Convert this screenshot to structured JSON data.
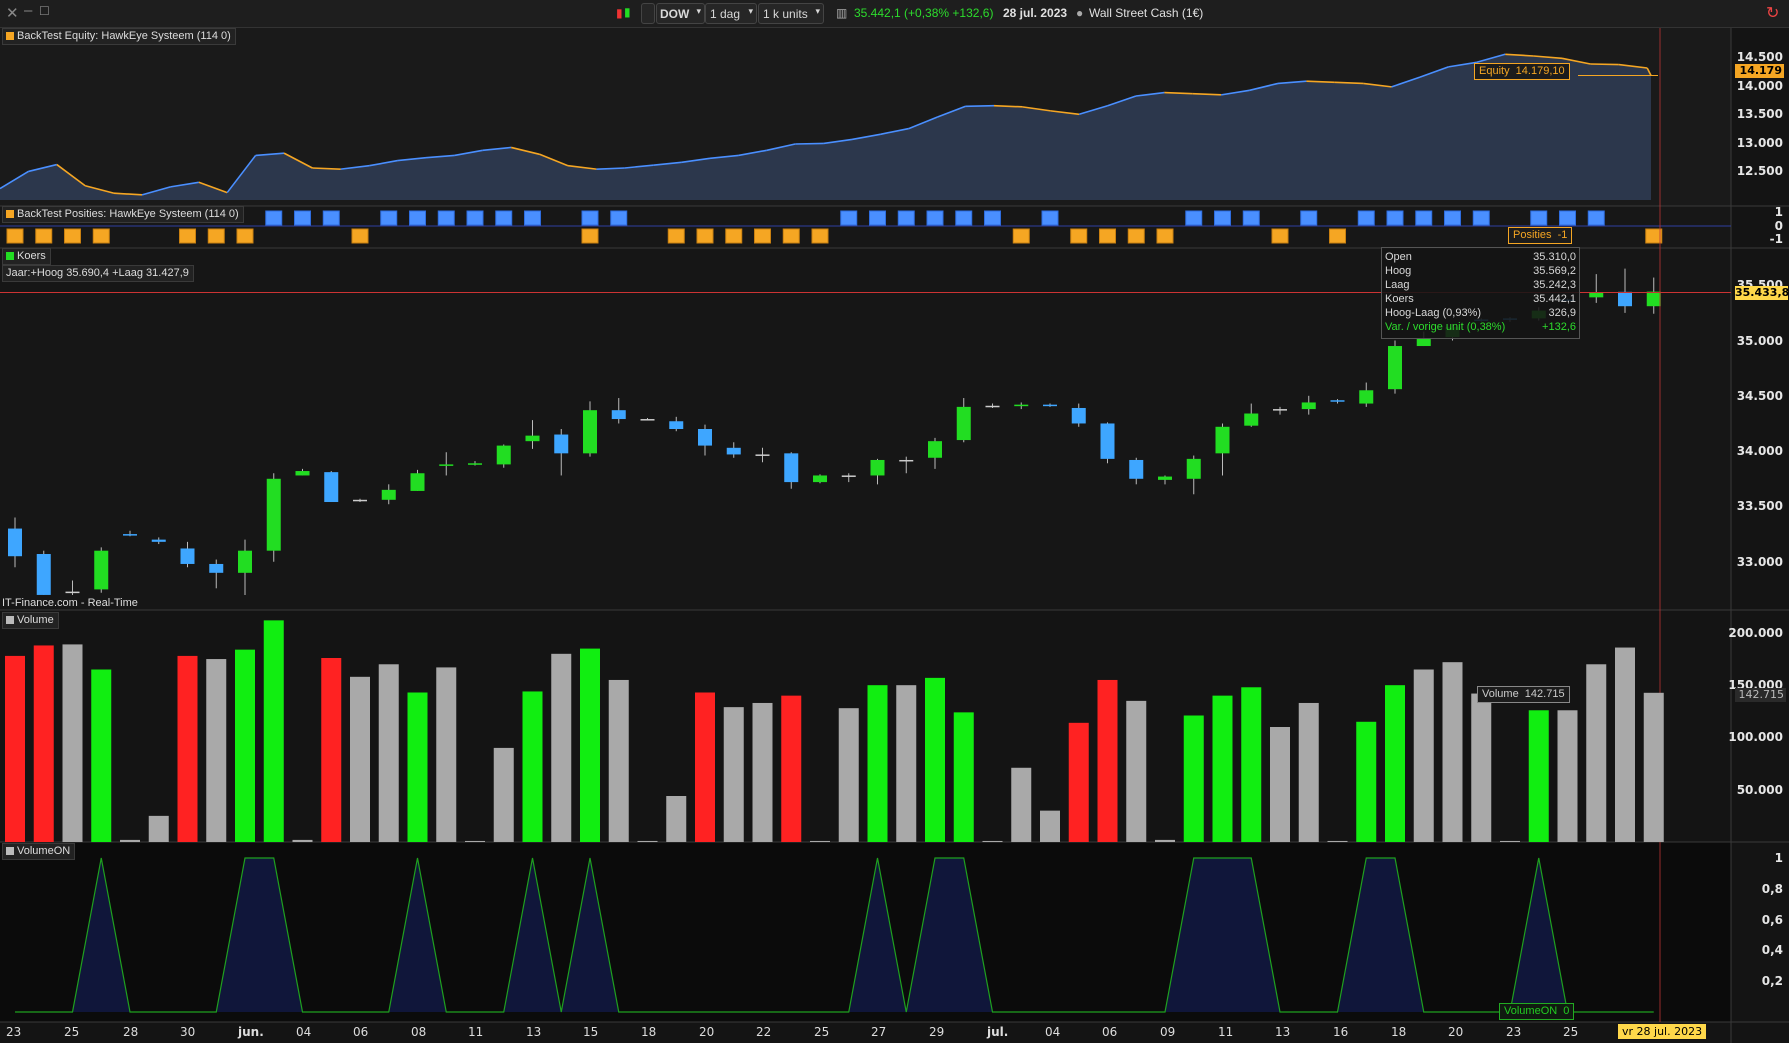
{
  "toolbar": {
    "symbol": "DOW",
    "period": "1 dag",
    "units": "1 k units",
    "quote": "35.442,1 (+0,38% +132,6)",
    "date": "28 jul. 2023",
    "instrument": "Wall Street Cash (1€)"
  },
  "panels": {
    "equity": {
      "label": "BackTest Equity: HawkEye Systeem (114 0)",
      "value_label": "Equity  14.179,10",
      "axis_value": "14.179",
      "ticks": [
        "14.500",
        "14.000",
        "13.500",
        "13.000",
        "12.500"
      ]
    },
    "positions": {
      "label": "BackTest Posities: HawkEye Systeem (114 0)",
      "value_label": "Posities  -1",
      "ticks": [
        "1",
        "0",
        "-1"
      ]
    },
    "price": {
      "label": "Koers",
      "subtitle": "Jaar:+Hoog 35.690,4 +Laag 31.427,9",
      "source": "IT-Finance.com - Real-Time",
      "current": "35.433,8",
      "ticks": [
        "35.500",
        "35.000",
        "34.500",
        "34.000",
        "33.500",
        "33.000"
      ]
    },
    "volume": {
      "label": "Volume",
      "value_label": "Volume  142.715",
      "current": "142.715",
      "ticks": [
        "200.000",
        "150.000",
        "100.000",
        "50.000"
      ]
    },
    "volumeon": {
      "label": "VolumeON",
      "value_label": "VolumeON  0",
      "ticks": [
        "1",
        "0,8",
        "0,6",
        "0,4",
        "0,2"
      ]
    }
  },
  "tooltip": [
    {
      "k": "Open",
      "v": "35.310,0"
    },
    {
      "k": "Hoog",
      "v": "35.569,2"
    },
    {
      "k": "Laag",
      "v": "35.242,3"
    },
    {
      "k": "Koers",
      "v": "35.442,1"
    },
    {
      "k": "Hoog-Laag (0,93%)",
      "v": "326,9"
    },
    {
      "k": "Var. / vorige unit (0,38%)",
      "v": "+132,6"
    }
  ],
  "xaxis": [
    "23",
    "25",
    "28",
    "30",
    "jun.",
    "04",
    "06",
    "08",
    "11",
    "13",
    "15",
    "18",
    "20",
    "22",
    "25",
    "27",
    "29",
    "jul.",
    "04",
    "06",
    "09",
    "11",
    "13",
    "16",
    "18",
    "20",
    "23",
    "25"
  ],
  "xaxis_current": "vr 28 jul. 2023",
  "colors": {
    "up": "#22dd22",
    "down": "#ff2222",
    "neutral": "#aaaaaa",
    "equity": "#f5a623",
    "equity_up": "#4a8fff",
    "blue_candle": "#3ea6ff"
  },
  "chart_data": [
    {
      "type": "line",
      "title": "BackTest Equity: HawkEye Systeem (114 0)",
      "ylim": [
        12000,
        14800
      ],
      "values": [
        12200,
        12500,
        12620,
        12250,
        12120,
        12090,
        12230,
        12310,
        12130,
        12780,
        12820,
        12560,
        12540,
        12600,
        12690,
        12740,
        12780,
        12870,
        12920,
        12800,
        12600,
        12540,
        12560,
        12610,
        12660,
        12730,
        12780,
        12870,
        12980,
        12990,
        13060,
        13150,
        13250,
        13450,
        13640,
        13650,
        13630,
        13560,
        13500,
        13650,
        13820,
        13880,
        13860,
        13840,
        13920,
        14040,
        14080,
        14060,
        14040,
        13980,
        14150,
        14330,
        14410,
        14550,
        14520,
        14480,
        14380,
        14370,
        14310,
        14179
      ]
    },
    {
      "type": "bar",
      "title": "Volume",
      "ylim": [
        0,
        220000
      ],
      "values": [
        178000,
        188000,
        189000,
        165000,
        2000,
        25000,
        178000,
        175000,
        184000,
        212000,
        2000,
        176000,
        158000,
        170000,
        143000,
        167000,
        1000,
        90000,
        144000,
        180000,
        185000,
        155000,
        1000,
        44000,
        143000,
        129000,
        133000,
        140000,
        1000,
        128000,
        150000,
        150000,
        157000,
        124000,
        1000,
        71000,
        30000,
        114000,
        155000,
        135000,
        2000,
        121000,
        140000,
        148000,
        110000,
        133000,
        1000,
        115000,
        150000,
        165000,
        172000,
        142000,
        1000,
        126000,
        126000,
        170000,
        186000,
        142715
      ],
      "colors": [
        "r",
        "r",
        "n",
        "g",
        "n",
        "n",
        "r",
        "n",
        "g",
        "g",
        "n",
        "r",
        "n",
        "n",
        "g",
        "n",
        "n",
        "n",
        "g",
        "n",
        "g",
        "n",
        "n",
        "n",
        "r",
        "n",
        "n",
        "r",
        "n",
        "n",
        "g",
        "n",
        "g",
        "g",
        "n",
        "n",
        "n",
        "r",
        "r",
        "n",
        "n",
        "g",
        "g",
        "g",
        "n",
        "n",
        "n",
        "g",
        "g",
        "n",
        "n",
        "n",
        "n",
        "g",
        "n",
        "n",
        "n",
        "n"
      ]
    },
    {
      "type": "line",
      "title": "VolumeON",
      "ylim": [
        0,
        1
      ],
      "values": [
        0,
        0,
        0,
        1,
        0,
        0,
        0,
        0,
        1,
        1,
        0,
        0,
        0,
        0,
        1,
        0,
        0,
        0,
        1,
        0,
        1,
        0,
        0,
        0,
        0,
        0,
        0,
        0,
        0,
        0,
        1,
        0,
        1,
        1,
        0,
        0,
        0,
        0,
        0,
        0,
        0,
        1,
        1,
        1,
        0,
        0,
        0,
        1,
        1,
        0,
        0,
        0,
        0,
        1,
        0,
        0,
        0,
        0
      ]
    },
    {
      "type": "candlestick",
      "title": "Koers",
      "ylim": [
        32600,
        35800
      ],
      "candles": [
        [
          33300,
          33050,
          33400,
          32950,
          "b"
        ],
        [
          33070,
          32700,
          33100,
          32700,
          "b"
        ],
        [
          32730,
          32720,
          32830,
          32700,
          "n"
        ],
        [
          32750,
          33100,
          33130,
          32720,
          "g"
        ],
        [
          33250,
          33240,
          33280,
          33230,
          "b"
        ],
        [
          33200,
          33180,
          33220,
          33160,
          "b"
        ],
        [
          33120,
          32980,
          33180,
          32950,
          "b"
        ],
        [
          32980,
          32900,
          33020,
          32760,
          "b"
        ],
        [
          32900,
          33100,
          33200,
          32700,
          "g"
        ],
        [
          33100,
          33750,
          33800,
          33000,
          "g"
        ],
        [
          33820,
          33780,
          33840,
          33780,
          "g"
        ],
        [
          33810,
          33540,
          33820,
          33540,
          "b"
        ],
        [
          33550,
          33560,
          33570,
          33540,
          "n"
        ],
        [
          33560,
          33650,
          33700,
          33520,
          "g"
        ],
        [
          33640,
          33800,
          33830,
          33640,
          "g"
        ],
        [
          33870,
          33880,
          33990,
          33780,
          "g"
        ],
        [
          33890,
          33880,
          33910,
          33870,
          "g"
        ],
        [
          33880,
          34050,
          34060,
          33850,
          "g"
        ],
        [
          34090,
          34140,
          34280,
          34020,
          "g"
        ],
        [
          34150,
          33980,
          34200,
          33780,
          "b"
        ],
        [
          33980,
          34370,
          34450,
          33950,
          "g"
        ],
        [
          34370,
          34290,
          34480,
          34250,
          "b"
        ],
        [
          34290,
          34290,
          34300,
          34280,
          "n"
        ],
        [
          34270,
          34200,
          34310,
          34180,
          "b"
        ],
        [
          34200,
          34050,
          34240,
          33960,
          "b"
        ],
        [
          34030,
          33970,
          34080,
          33940,
          "b"
        ],
        [
          33970,
          33960,
          34030,
          33900,
          "n"
        ],
        [
          33980,
          33720,
          33990,
          33660,
          "b"
        ],
        [
          33720,
          33780,
          33790,
          33710,
          "g"
        ],
        [
          33780,
          33780,
          33800,
          33720,
          "n"
        ],
        [
          33780,
          33920,
          33930,
          33700,
          "g"
        ],
        [
          33920,
          33920,
          33950,
          33800,
          "n"
        ],
        [
          33940,
          34090,
          34120,
          33840,
          "g"
        ],
        [
          34100,
          34400,
          34480,
          34080,
          "g"
        ],
        [
          34410,
          34410,
          34430,
          34390,
          "n"
        ],
        [
          34410,
          34420,
          34440,
          34380,
          "g"
        ],
        [
          34410,
          34420,
          34430,
          34400,
          "b"
        ],
        [
          34390,
          34250,
          34430,
          34220,
          "b"
        ],
        [
          34250,
          33930,
          34260,
          33890,
          "b"
        ],
        [
          33920,
          33750,
          33940,
          33700,
          "b"
        ],
        [
          33770,
          33740,
          33780,
          33700,
          "g"
        ],
        [
          33750,
          33930,
          33960,
          33610,
          "g"
        ],
        [
          33980,
          34220,
          34250,
          33780,
          "g"
        ],
        [
          34230,
          34340,
          34430,
          34220,
          "g"
        ],
        [
          34380,
          34380,
          34400,
          34330,
          "n"
        ],
        [
          34380,
          34440,
          34500,
          34330,
          "g"
        ],
        [
          34460,
          34450,
          34470,
          34430,
          "b"
        ],
        [
          34430,
          34550,
          34620,
          34400,
          "g"
        ],
        [
          34560,
          34950,
          35000,
          34520,
          "g"
        ],
        [
          34950,
          35020,
          35080,
          34950,
          "g"
        ],
        [
          35030,
          35120,
          35150,
          35000,
          "g"
        ],
        [
          35180,
          35190,
          35200,
          35170,
          "b"
        ],
        [
          35200,
          35190,
          35210,
          35170,
          "b"
        ],
        [
          35200,
          35270,
          35300,
          35180,
          "g"
        ],
        [
          35360,
          35370,
          35380,
          35350,
          "b"
        ],
        [
          35390,
          35430,
          35600,
          35340,
          "g"
        ],
        [
          35440,
          35310,
          35650,
          35250,
          "b"
        ],
        [
          35310,
          35442,
          35569,
          35242,
          "g"
        ]
      ]
    }
  ]
}
